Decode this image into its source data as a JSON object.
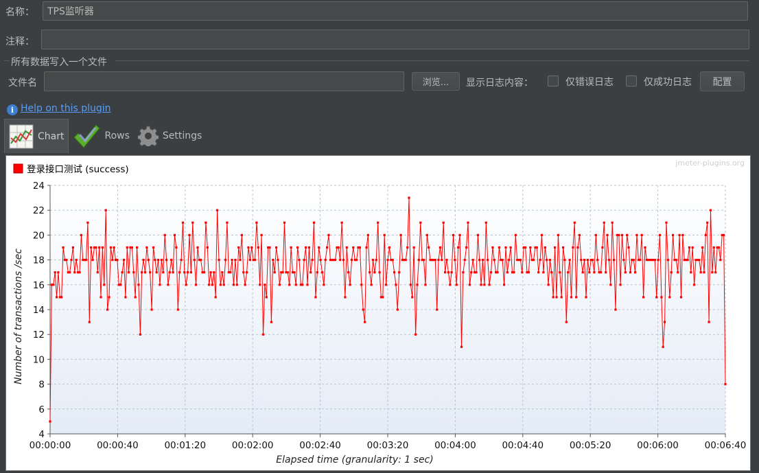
{
  "form": {
    "name_label": "名称：",
    "name_value": "TPS监听器",
    "comment_label": "注释：",
    "comment_value": "",
    "group_title": "所有数据写入一个文件",
    "file_label": "文件名",
    "file_value": "",
    "browse_label": "浏览...",
    "log_content_label": "显示日志内容：",
    "errors_only_label": "仅错误日志",
    "errors_only_checked": false,
    "success_only_label": "仅成功日志",
    "success_only_checked": false,
    "config_label": "配置"
  },
  "help": {
    "link_text": "Help on this plugin"
  },
  "tabs": [
    {
      "label": "Chart",
      "icon": "chart-icon",
      "active": true
    },
    {
      "label": "Rows",
      "icon": "rows-check-icon",
      "active": false
    },
    {
      "label": "Settings",
      "icon": "gear-icon",
      "active": false
    }
  ],
  "chart_data": {
    "type": "line",
    "watermark": "jmeter-plugins.org",
    "xlabel": "Elapsed time (granularity: 1 sec)",
    "ylabel": "Number of transactions /sec",
    "xlim": [
      0,
      400
    ],
    "ylim": [
      4,
      24
    ],
    "x_ticks": [
      "00:00:00",
      "00:00:40",
      "00:01:20",
      "00:02:00",
      "00:02:40",
      "00:03:20",
      "00:04:00",
      "00:04:40",
      "00:05:20",
      "00:06:00",
      "00:06:40"
    ],
    "y_ticks": [
      4,
      6,
      8,
      10,
      12,
      14,
      16,
      18,
      20,
      22,
      24
    ],
    "grid": true,
    "legend_position": "top-left",
    "series": [
      {
        "name": "登录接口测试 (success)",
        "color": "#ff0000",
        "values": [
          5,
          16,
          16,
          17,
          15,
          17,
          15,
          15,
          19,
          18,
          18,
          17,
          17,
          18,
          19,
          17,
          18,
          17,
          17,
          20,
          18,
          18,
          18,
          21,
          13,
          19,
          18,
          19,
          19,
          17,
          19,
          15,
          19,
          16,
          22,
          14,
          15,
          19,
          18,
          19,
          18,
          18,
          16,
          16,
          17,
          18,
          15,
          19,
          17,
          19,
          19,
          17,
          15,
          19,
          16,
          12,
          17,
          18,
          17,
          19,
          18,
          17,
          14,
          19,
          18,
          17,
          18,
          16,
          18,
          17,
          20,
          18,
          16,
          17,
          18,
          17,
          20,
          19,
          14,
          17,
          18,
          21,
          17,
          16,
          17,
          20,
          17,
          21,
          18,
          16,
          19,
          18,
          18,
          17,
          17,
          21,
          19,
          16,
          17,
          16,
          17,
          15,
          22,
          18,
          16,
          17,
          16,
          18,
          21,
          17,
          17,
          18,
          16,
          18,
          16,
          19,
          18,
          20,
          17,
          16,
          17,
          19,
          18,
          19,
          18,
          18,
          21,
          19,
          16,
          20,
          12,
          16,
          15,
          19,
          19,
          13,
          18,
          17,
          19,
          18,
          16,
          17,
          17,
          21,
          17,
          17,
          16,
          19,
          17,
          17,
          16,
          19,
          18,
          16,
          16,
          18,
          19,
          16,
          19,
          17,
          18,
          21,
          15,
          17,
          19,
          18,
          17,
          16,
          18,
          19,
          20,
          18,
          18,
          18,
          18,
          19,
          19,
          18,
          21,
          18,
          15,
          19,
          17,
          16,
          18,
          19,
          18,
          18,
          19,
          19,
          16,
          14,
          13,
          19,
          20,
          17,
          16,
          18,
          17,
          18,
          21,
          17,
          15,
          15,
          20,
          16,
          18,
          19,
          18,
          18,
          17,
          16,
          14,
          17,
          20,
          18,
          18,
          18,
          19,
          23,
          16,
          15,
          19,
          12,
          16,
          18,
          21,
          18,
          18,
          16,
          20,
          19,
          18,
          18,
          18,
          18,
          14,
          18,
          19,
          18,
          21,
          17,
          18,
          17,
          16,
          17,
          20,
          18,
          16,
          19,
          20,
          11,
          17,
          18,
          19,
          21,
          16,
          17,
          18,
          17,
          17,
          20,
          18,
          16,
          18,
          16,
          21,
          18,
          16,
          17,
          19,
          18,
          17,
          17,
          19,
          18,
          18,
          16,
          19,
          17,
          18,
          19,
          17,
          17,
          20,
          18,
          18,
          18,
          17,
          19,
          19,
          17,
          17,
          19,
          18,
          18,
          19,
          19,
          17,
          18,
          20,
          17,
          19,
          18,
          16,
          18,
          17,
          15,
          19,
          15,
          20,
          17,
          15,
          19,
          18,
          13,
          17,
          18,
          15,
          19,
          21,
          15,
          19,
          20,
          18,
          17,
          18,
          15,
          18,
          17,
          18,
          18,
          17,
          20,
          18,
          17,
          17,
          19,
          21,
          17,
          20,
          18,
          16,
          21,
          18,
          14,
          20,
          20,
          16,
          20,
          18,
          17,
          20,
          19,
          17,
          18,
          18,
          17,
          20,
          18,
          18,
          20,
          15,
          19,
          18,
          18,
          18,
          18,
          18,
          18,
          15,
          18,
          20,
          15,
          11,
          13,
          21,
          18,
          15,
          17,
          20,
          18,
          18,
          17,
          20,
          15,
          20,
          18,
          18,
          18,
          19,
          17,
          19,
          16,
          18,
          18,
          18,
          17,
          19,
          17,
          20,
          21,
          13,
          22,
          17,
          19,
          17,
          19,
          19,
          18,
          20,
          20,
          8
        ]
      }
    ]
  }
}
